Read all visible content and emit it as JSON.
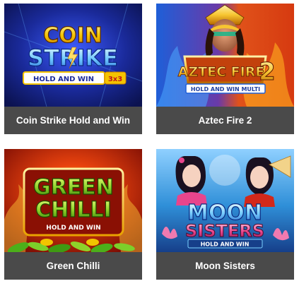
{
  "games": [
    {
      "title": "Coin Strike Hold and Win",
      "logo_line1": "COIN",
      "logo_line2": "STRIKE",
      "logo_badge": "HOLD AND WIN",
      "logo_badge_extra": "3x3",
      "colors": {
        "bg": "#1a2a9a",
        "accent": "#f5c400"
      }
    },
    {
      "title": "Aztec Fire 2",
      "logo_line1": "AZTEC FIRE",
      "logo_number": "2",
      "logo_badge": "HOLD AND WIN MULTI",
      "colors": {
        "bg_left": "#1e5fd8",
        "bg_right": "#d63a10",
        "accent": "#f7c531"
      }
    },
    {
      "title": "Green Chilli",
      "logo_line1": "GREEN",
      "logo_line2": "CHILLI",
      "logo_badge": "HOLD AND WIN",
      "colors": {
        "bg": "#c41e08",
        "accent": "#8ed22a"
      }
    },
    {
      "title": "Moon Sisters",
      "logo_line1": "MOON",
      "logo_line2": "SISTERS",
      "logo_badge": "HOLD AND WIN",
      "colors": {
        "bg": "#2f8fd8",
        "accent": "#e8458c"
      }
    }
  ]
}
